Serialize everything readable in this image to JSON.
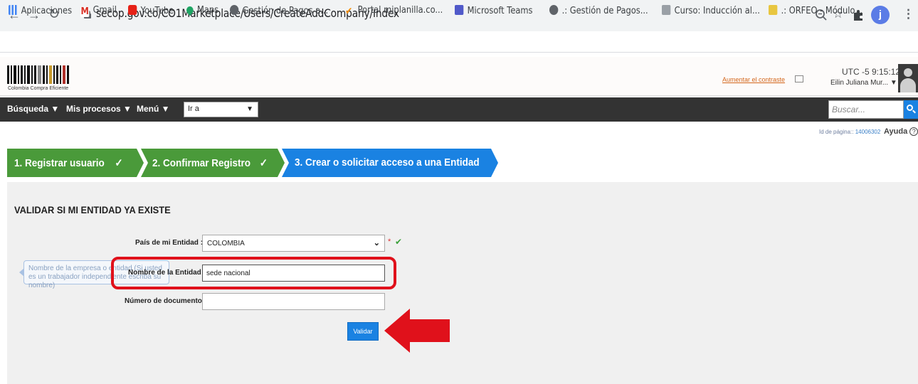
{
  "browser": {
    "url": "secop.gov.co/CO1Marketplace/Users/CreateAddCompany/Index",
    "profile_initial": "j",
    "bookmarks": [
      {
        "label": "Aplicaciones",
        "icon": "apps-grid-icon"
      },
      {
        "label": "Gmail",
        "icon": "gmail-icon"
      },
      {
        "label": "YouTube",
        "icon": "youtube-icon"
      },
      {
        "label": "Maps",
        "icon": "maps-pin-icon"
      },
      {
        "label": "Gestión de Pagos a...",
        "icon": "globe-icon"
      },
      {
        "label": "Portal miplanilla.co...",
        "icon": "checkmark-icon"
      },
      {
        "label": "Microsoft Teams",
        "icon": "teams-icon"
      },
      {
        "label": ".: Gestión de Pagos...",
        "icon": "globe-icon"
      },
      {
        "label": "Curso: Inducción al...",
        "icon": "page-icon"
      },
      {
        "label": ".: ORFEO - Módulo...",
        "icon": "orfeo-icon"
      }
    ]
  },
  "header": {
    "logo_text": "Colombia Compra Eficiente",
    "contrast_link": "Aumentar el contraste",
    "time": "UTC -5 9:15:12",
    "user_name": "Eilin Juliana Mur..."
  },
  "nav": {
    "busqueda": "Búsqueda",
    "mis_procesos": "Mis procesos",
    "menu": "Menú",
    "ir_a": "Ir a",
    "search_placeholder": "Buscar..."
  },
  "page_meta": {
    "page_id_label": "Id de página::",
    "page_id": "14006302",
    "help": "Ayuda"
  },
  "steps": [
    {
      "label": "1. Registrar usuario",
      "state": "done",
      "color": "#4a9a3a"
    },
    {
      "label": "2. Confirmar Registro",
      "state": "done",
      "color": "#4a9a3a"
    },
    {
      "label": "3. Crear o solicitar acceso a una Entidad",
      "state": "current",
      "color": "#1a82e2"
    }
  ],
  "form": {
    "title": "VALIDAR SI MI ENTIDAD YA EXISTE",
    "country_label": "País de mi Entidad :",
    "country_value": "COLOMBIA",
    "name_label": "Nombre de la Entidad :",
    "name_value": "sede nacional",
    "tooltip": "Nombre de la empresa o entidad (Si usted es un trabajador independiente escriba su nombre)",
    "doc_label": "Número de documento :",
    "doc_value": "",
    "submit": "Validar"
  },
  "colors": {
    "accent": "#1a82e2",
    "step_done": "#4a9a3a",
    "highlight": "#e0111b"
  }
}
